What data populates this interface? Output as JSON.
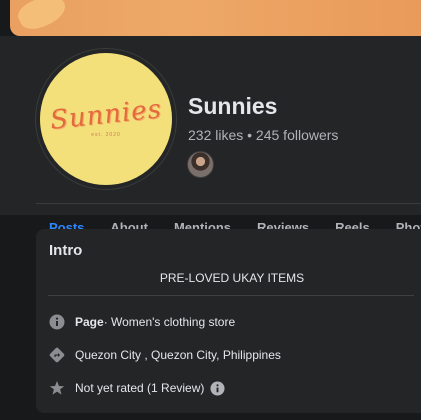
{
  "page": {
    "name": "Sunnies",
    "stats": "232 likes • 245 followers"
  },
  "avatar": {
    "logo_text": "Sunnies",
    "logo_sub": "est. 2020"
  },
  "tabs": [
    {
      "label": "Posts",
      "active": true
    },
    {
      "label": "About"
    },
    {
      "label": "Mentions"
    },
    {
      "label": "Reviews"
    },
    {
      "label": "Reels"
    },
    {
      "label": "Photos"
    }
  ],
  "intro": {
    "title": "Intro",
    "bio": "PRE-LOVED UKAY ITEMS",
    "category_label": "Page",
    "category_value": " · Women's clothing store",
    "location": "Quezon City , Quezon City, Philippines",
    "rating": "Not yet rated (1 Review)"
  },
  "colors": {
    "accent": "#2d88ff",
    "card_bg": "#242526",
    "page_bg": "#18191a",
    "cover": "#eda867",
    "avatar_bg": "#f4e07a"
  },
  "icons": [
    "info-icon",
    "directions-icon",
    "star-icon",
    "info-small-icon"
  ]
}
